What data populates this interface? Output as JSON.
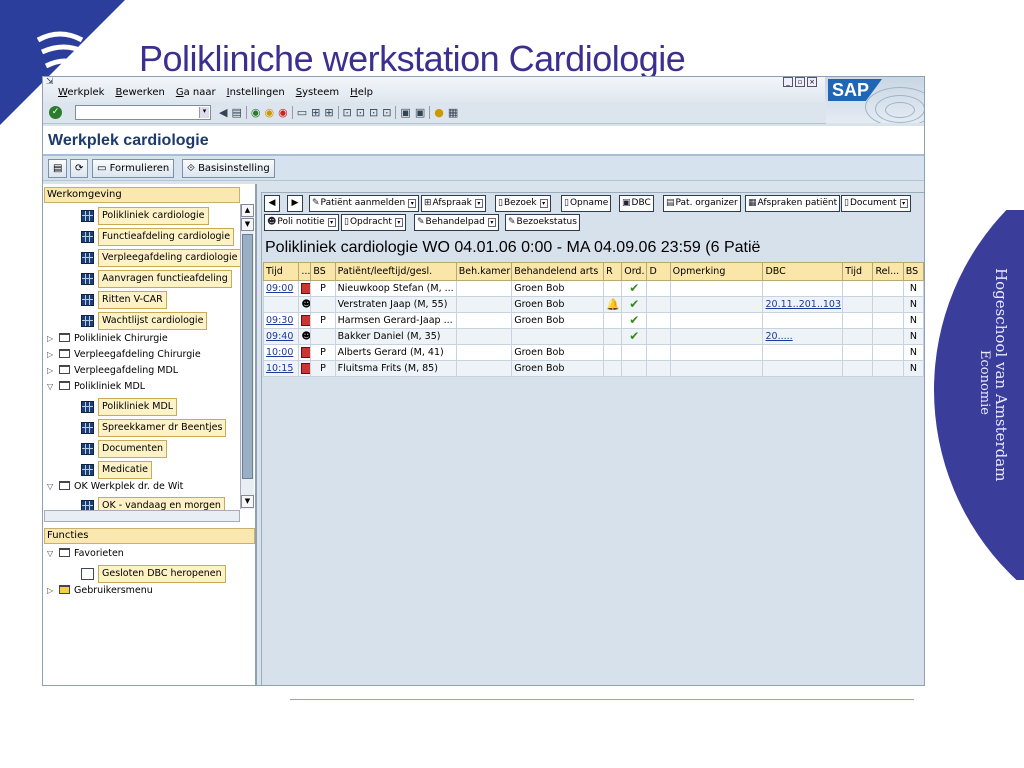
{
  "slide": {
    "title": "Polikliniche werkstation Cardiologie",
    "school_line1": "Hogeschool van Amsterdam",
    "school_line2": "Economie"
  },
  "menubar": {
    "items": [
      "Werkplek",
      "Bewerken",
      "Ga naar",
      "Instellingen",
      "Systeem",
      "Help"
    ]
  },
  "sap_logo": "SAP",
  "screen_title": "Werkplek cardiologie",
  "app_toolbar": {
    "formulieren": "Formulieren",
    "basisinstelling": "Basisinstelling"
  },
  "tree": {
    "werkomgeving_header": "Werkomgeving",
    "functies_header": "Functies",
    "items": [
      "Polikliniek cardiologie",
      "Functieafdeling cardiologie",
      "Verpleegafdeling cardiologie",
      "Aanvragen functieafdeling",
      "Ritten V-CAR",
      "Wachtlijst cardiologie",
      "Polikliniek Chirurgie",
      "Verpleegafdeling Chirurgie",
      "Verpleegafdeling MDL",
      "Polikliniek MDL",
      "Polikliniek MDL",
      "Spreekkamer dr Beentjes",
      "Documenten",
      "Medicatie",
      "OK Werkplek dr. de Wit",
      "OK - vandaag en morgen"
    ],
    "favorieten": "Favorieten",
    "gesloten_dbc": "Gesloten DBC heropenen",
    "gebruikersmenu": "Gebruikersmenu"
  },
  "buttons_row1": [
    "Patiënt aanmelden",
    "Afspraak",
    "Bezoek",
    "Opname",
    "DBC",
    "Pat. organizer",
    "Afspraken patiënt",
    "Document"
  ],
  "buttons_row2": [
    "Poli notitie",
    "Opdracht",
    "Behandelpad",
    "Bezoekstatus"
  ],
  "period_header": "Polikliniek cardiologie WO 04.01.06  0:00 - MA 04.09.06 23:59 (6 Patië",
  "table": {
    "columns": [
      "Tijd",
      "...",
      "BS",
      "Patiënt/leeftijd/gesl.",
      "Beh.kamer",
      "Behandelend arts",
      "R",
      "Ord.",
      "D",
      "Opmerking",
      "DBC",
      "Tijd",
      "Rel...",
      "BS"
    ],
    "rows": [
      {
        "tijd": "09:00",
        "bs": "P",
        "patient": "Nieuwkoop Stefan (M, ...",
        "arts": "Groen Bob",
        "r": "",
        "ord": "✔",
        "dbc": "",
        "bs2": "N"
      },
      {
        "tijd": "",
        "bs": "",
        "patient": "Verstraten Jaap (M, 55)",
        "arts": "Groen Bob",
        "r": "bell",
        "ord": "✔",
        "dbc": "20.11..201..103",
        "bs2": "N"
      },
      {
        "tijd": "09:30",
        "bs": "P",
        "patient": "Harmsen Gerard-Jaap ...",
        "arts": "Groen Bob",
        "r": "",
        "ord": "✔",
        "dbc": "",
        "bs2": "N"
      },
      {
        "tijd": "09:40",
        "bs": "",
        "patient": "Bakker Daniel (M, 35)",
        "arts": "",
        "r": "",
        "ord": "✔",
        "dbc": "20.....",
        "bs2": "N"
      },
      {
        "tijd": "10:00",
        "bs": "P",
        "patient": "Alberts Gerard (M, 41)",
        "arts": "Groen Bob",
        "r": "",
        "ord": "",
        "dbc": "",
        "bs2": "N"
      },
      {
        "tijd": "10:15",
        "bs": "P",
        "patient": "Fluitsma Frits (M, 85)",
        "arts": "Groen Bob",
        "r": "",
        "ord": "",
        "dbc": "",
        "bs2": "N"
      }
    ]
  },
  "colors": {
    "accent": "#2b3e9c",
    "title": "#3c2f8f",
    "header": "#fbe6a9"
  }
}
